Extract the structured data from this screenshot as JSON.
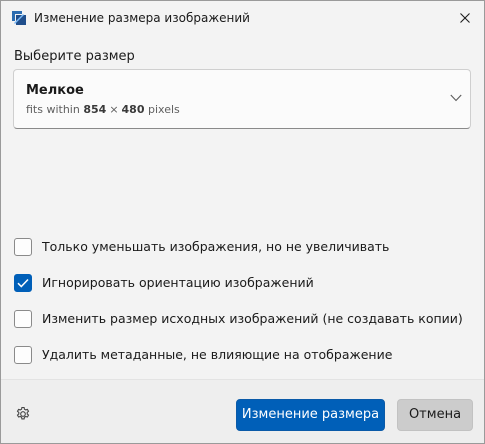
{
  "window": {
    "title": "Изменение размера изображений"
  },
  "size_picker": {
    "label": "Выберите размер",
    "selected_name": "Мелкое",
    "desc_prefix": "fits within",
    "width": "854",
    "times": "×",
    "height": "480",
    "unit": "pixels"
  },
  "options": [
    {
      "label": "Только уменьшать изображения, но не увеличивать",
      "checked": false
    },
    {
      "label": "Игнорировать ориентацию изображений",
      "checked": true
    },
    {
      "label": "Изменить размер исходных изображений (не создавать копии)",
      "checked": false
    },
    {
      "label": "Удалить метаданные, не влияющие на отображение",
      "checked": false
    }
  ],
  "footer": {
    "resize_label": "Изменение размера",
    "cancel_label": "Отмена"
  },
  "colors": {
    "accent": "#005fb8",
    "background": "#f3f3f3",
    "footer": "#eeeeee"
  },
  "icons": {
    "app": "image-resizer-icon",
    "close": "close-icon",
    "dropdown": "chevron-down-icon",
    "settings": "gear-icon",
    "check": "checkmark-icon"
  }
}
